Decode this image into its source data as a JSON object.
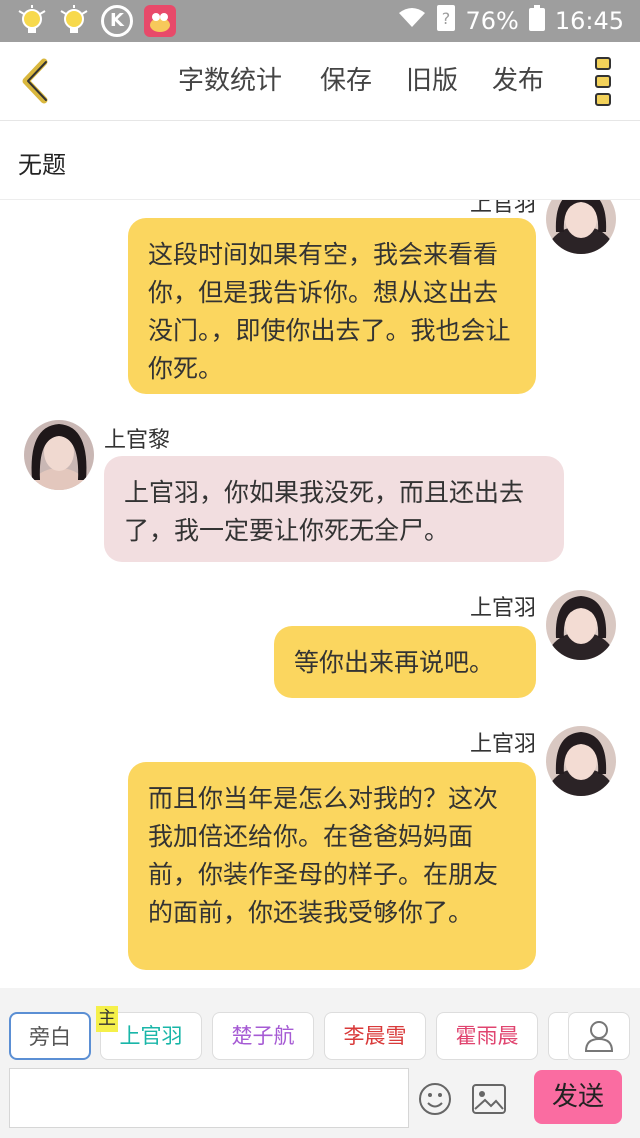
{
  "status_bar": {
    "battery": "76%",
    "time": "16:45",
    "k_label": "K"
  },
  "toolbar": {
    "word_count": "字数统计",
    "save": "保存",
    "old_version": "旧版",
    "publish": "发布"
  },
  "document": {
    "title": "无题"
  },
  "messages": [
    {
      "side": "right",
      "name": "上官羽",
      "text": "这段时间如果有空，我会来看看你，但是我告诉你。想从这出去没门。，即使你出去了。我也会让你死。"
    },
    {
      "side": "left",
      "name": "上官黎",
      "text": "上官羽，你如果我没死，而且还出去了，我一定要让你死无全尸。"
    },
    {
      "side": "right",
      "name": "上官羽",
      "text": "等你出来再说吧。"
    },
    {
      "side": "right",
      "name": "上官羽",
      "text": "而且你当年是怎么对我的？这次我加倍还给你。在爸爸妈妈面前，你装作圣母的样子。在朋友的面前，你还装我受够你了。"
    }
  ],
  "roles": [
    {
      "label": "旁白",
      "color": "#555555"
    },
    {
      "label": "上官羽",
      "color": "#19b6a8"
    },
    {
      "label": "楚子航",
      "color": "#a65bd4"
    },
    {
      "label": "李晨雪",
      "color": "#d93a3a"
    },
    {
      "label": "霍雨晨",
      "color": "#e0446f"
    }
  ],
  "main_tag": "主",
  "send_label": "发送"
}
